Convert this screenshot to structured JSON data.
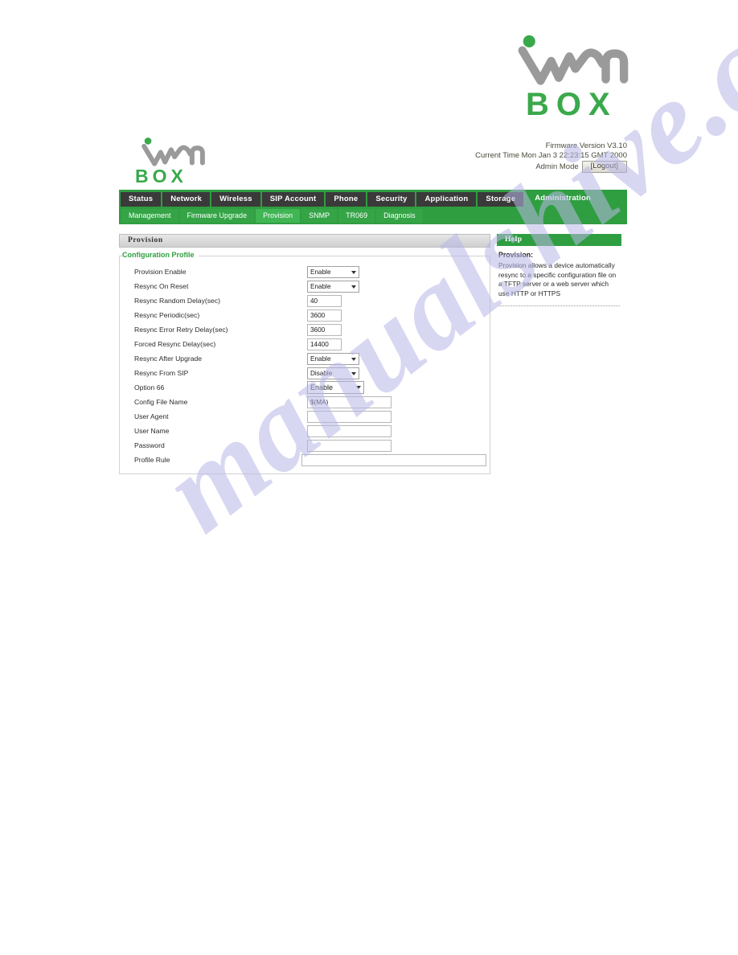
{
  "brand": {
    "name_top": "wLan",
    "word_top": "BOX",
    "name_small": "wLan",
    "word_small": "BOX"
  },
  "status": {
    "firmware": "Firmware Version V3.10",
    "current_time": "Current Time Mon Jan 3 22:23:15 GMT 2000",
    "admin_mode_label": "Admin Mode",
    "logout_label": "[Logout]"
  },
  "nav": {
    "main_tabs": [
      {
        "label": "Status",
        "active": false
      },
      {
        "label": "Network",
        "active": false
      },
      {
        "label": "Wireless",
        "active": false
      },
      {
        "label": "SIP Account",
        "active": false
      },
      {
        "label": "Phone",
        "active": false
      },
      {
        "label": "Security",
        "active": false
      },
      {
        "label": "Application",
        "active": false
      },
      {
        "label": "Storage",
        "active": false
      },
      {
        "label": "Administration",
        "active": true
      }
    ],
    "sub_tabs": [
      {
        "label": "Management",
        "active": false
      },
      {
        "label": "Firmware Upgrade",
        "active": false
      },
      {
        "label": "Provision",
        "active": true
      },
      {
        "label": "SNMP",
        "active": false
      },
      {
        "label": "TR069",
        "active": false
      },
      {
        "label": "Diagnosis",
        "active": false
      }
    ]
  },
  "panel": {
    "title": "Provision",
    "legend": "Configuration Profile",
    "fields": [
      {
        "label": "Provision Enable",
        "type": "select",
        "value": "Enable",
        "size": "sel"
      },
      {
        "label": "Resync On Reset",
        "type": "select",
        "value": "Enable",
        "size": "sel"
      },
      {
        "label": "Resync Random Delay(sec)",
        "type": "text",
        "value": "40",
        "size": "txt"
      },
      {
        "label": "Resync Periodic(sec)",
        "type": "text",
        "value": "3600",
        "size": "txt"
      },
      {
        "label": "Resync Error Retry Delay(sec)",
        "type": "text",
        "value": "3600",
        "size": "txt"
      },
      {
        "label": "Forced Resync Delay(sec)",
        "type": "text",
        "value": "14400",
        "size": "txt"
      },
      {
        "label": "Resync After Upgrade",
        "type": "select",
        "value": "Enable",
        "size": "sel"
      },
      {
        "label": "Resync From SIP",
        "type": "select",
        "value": "Disable",
        "size": "sel"
      },
      {
        "label": "Option 66",
        "type": "select",
        "value": "Enable",
        "size": "sel wide"
      },
      {
        "label": "Config File Name",
        "type": "text",
        "value": "$(MA)",
        "size": "txt med"
      },
      {
        "label": "User Agent",
        "type": "text",
        "value": "",
        "size": "txt med"
      },
      {
        "label": "User Name",
        "type": "text",
        "value": "",
        "size": "txt med"
      },
      {
        "label": "Password",
        "type": "text",
        "value": "",
        "size": "txt med"
      },
      {
        "label": "Profile Rule",
        "type": "text",
        "value": "",
        "size": "txt xlong"
      }
    ]
  },
  "help": {
    "title": "Help",
    "heading": "Provision:",
    "text": "Provision allows a device automatically resync to a specific configuration file on a TFTP server or a web server which use HTTP or HTTPS"
  },
  "watermark": {
    "text": "manualshive.com"
  },
  "colors": {
    "brand_green": "#2f9e41",
    "tab_dark": "#3a3a3a",
    "logo_gray": "#9a9a9a",
    "watermark": "#b9b8e8"
  }
}
